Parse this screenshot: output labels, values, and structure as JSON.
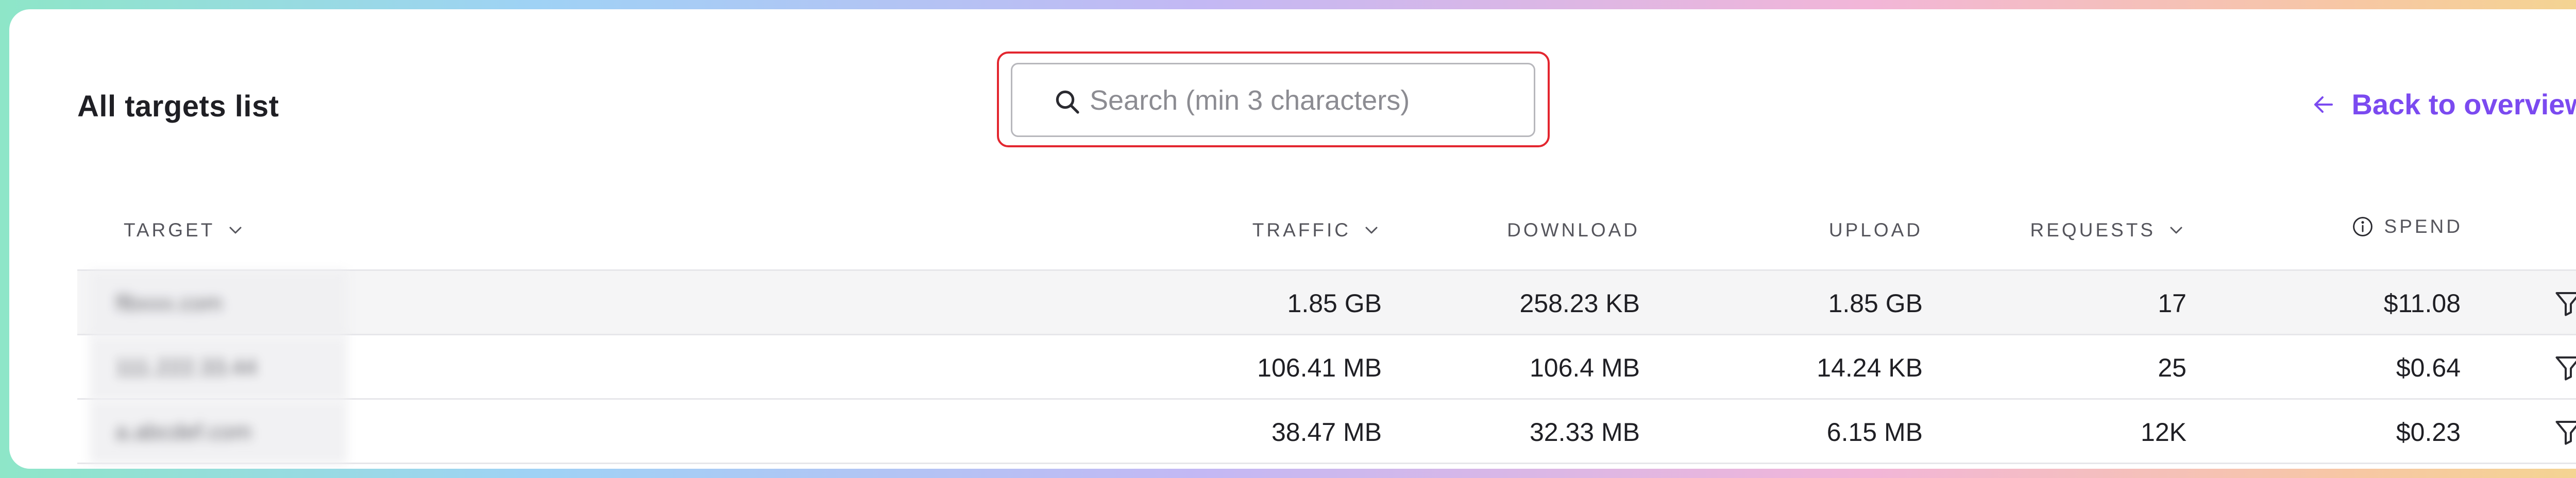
{
  "header": {
    "title": "All targets list",
    "back_label": "Back to overview"
  },
  "search": {
    "placeholder": "Search (min 3 characters)",
    "value": ""
  },
  "table": {
    "columns": {
      "target": "TARGET",
      "traffic": "TRAFFIC",
      "download": "DOWNLOAD",
      "upload": "UPLOAD",
      "requests": "REQUESTS",
      "spend": "SPEND"
    },
    "rows": [
      {
        "target": "flbxxx.com",
        "traffic": "1.85 GB",
        "download": "258.23 KB",
        "upload": "1.85 GB",
        "requests": "17",
        "spend": "$11.08"
      },
      {
        "target": "111.222.33.44",
        "traffic": "106.41 MB",
        "download": "106.4 MB",
        "upload": "14.24 KB",
        "requests": "25",
        "spend": "$0.64"
      },
      {
        "target": "a.abcdef.com",
        "traffic": "38.47 MB",
        "download": "32.33 MB",
        "upload": "6.15 MB",
        "requests": "12K",
        "spend": "$0.23"
      }
    ]
  },
  "icons": {
    "search": "search-icon",
    "back": "arrow-left-icon",
    "sort": "chevron-down-icon",
    "info": "info-icon",
    "filter": "filter-icon"
  },
  "colors": {
    "accent": "#7b4af0",
    "highlight_border": "#e3262f"
  }
}
